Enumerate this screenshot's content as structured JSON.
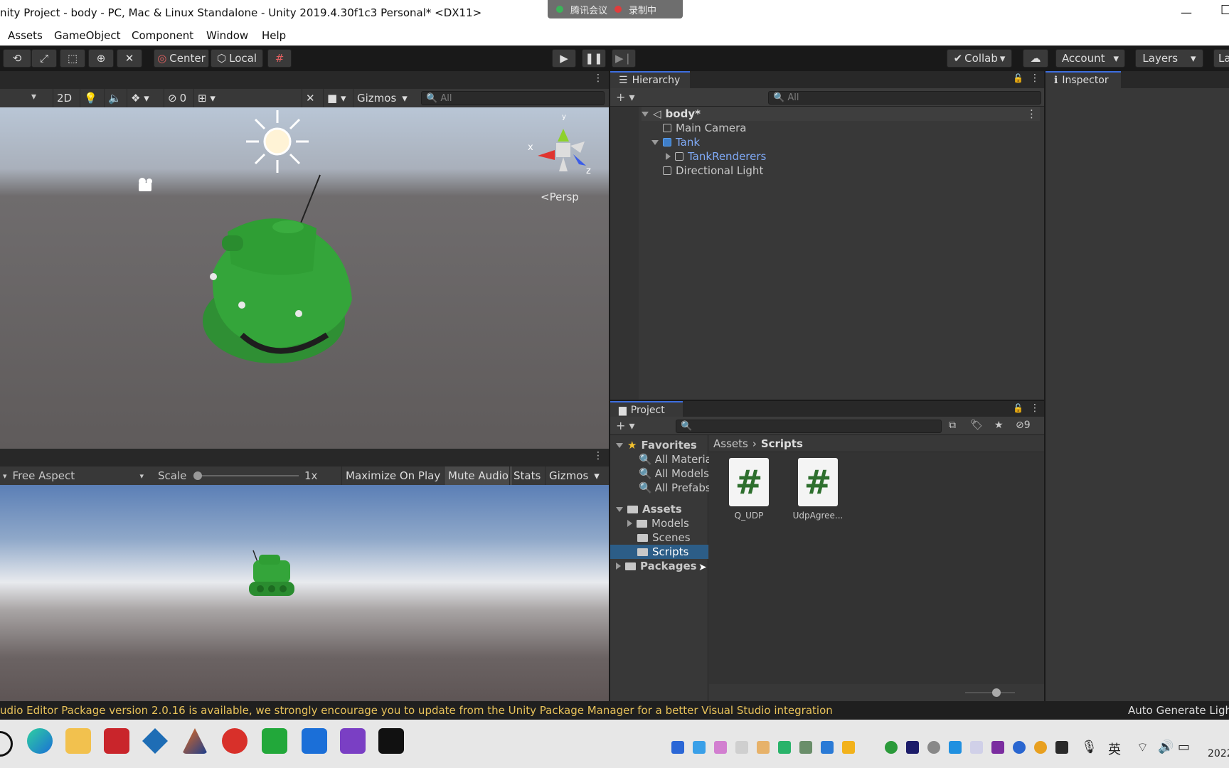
{
  "window": {
    "title": "nity Project - body - PC, Mac & Linux Standalone - Unity 2019.4.30f1c3 Personal* <DX11>",
    "meeting_app": "腾讯会议",
    "recording": "录制中"
  },
  "menu": {
    "items": [
      "Assets",
      "GameObject",
      "Component",
      "Window",
      "Help"
    ]
  },
  "toolbar": {
    "pivot": "Center",
    "space": "Local",
    "collab": "Collab",
    "account": "Account",
    "layers": "Layers",
    "layout": "La"
  },
  "scene": {
    "mode_2d": "2D",
    "hidden_count": "0",
    "gizmos": "Gizmos",
    "search_placeholder": "All",
    "persp": "Persp",
    "axis_x": "x",
    "axis_y": "y",
    "axis_z": "z"
  },
  "game": {
    "aspect": "Free Aspect",
    "scale_label": "Scale",
    "scale_value": "1x",
    "maximize": "Maximize On Play",
    "mute": "Mute Audio",
    "stats": "Stats",
    "gizmos": "Gizmos"
  },
  "hierarchy": {
    "tab": "Hierarchy",
    "search_placeholder": "All",
    "scene_name": "body*",
    "items": [
      "Main Camera",
      "Tank",
      "TankRenderers",
      "Directional Light"
    ]
  },
  "inspector": {
    "tab": "Inspector"
  },
  "project": {
    "tab": "Project",
    "hidden_count": "9",
    "favorites_label": "Favorites",
    "favorites": [
      "All Materia",
      "All Models",
      "All Prefabs"
    ],
    "assets_label": "Assets",
    "asset_folders": [
      "Models",
      "Scenes",
      "Scripts"
    ],
    "packages_label": "Packages",
    "breadcrumb": [
      "Assets",
      "Scripts"
    ],
    "files": [
      {
        "name": "Q_UDP",
        "glyph": "#"
      },
      {
        "name": "UdpAgree...",
        "glyph": "#"
      }
    ]
  },
  "status": {
    "message": "udio Editor Package version 2.0.16 is available, we strongly encourage you to update from the Unity Package Manager for a better Visual Studio integration",
    "right": "Auto Generate Light"
  },
  "taskbar": {
    "ime": "英",
    "clock": "2022"
  },
  "colors": {
    "accent": "#3d6ee0",
    "selected": "#2c5d87",
    "status_warning": "#e8c25a",
    "tank_green": "#2f9e34"
  }
}
